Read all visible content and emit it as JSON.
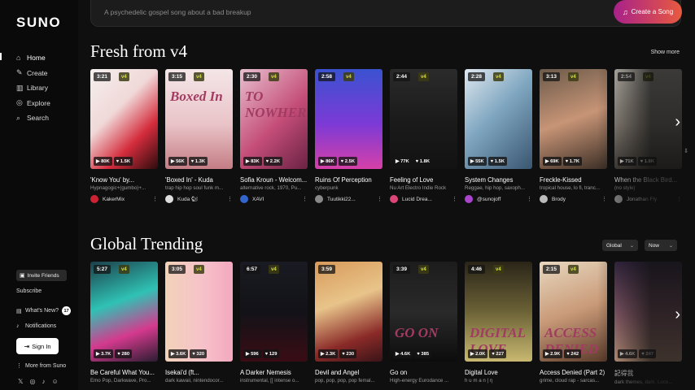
{
  "app": {
    "logo": "SUNO"
  },
  "nav": [
    {
      "label": "Home",
      "icon": "home-icon",
      "glyph": "⌂"
    },
    {
      "label": "Create",
      "icon": "create-icon",
      "glyph": "✎"
    },
    {
      "label": "Library",
      "icon": "library-icon",
      "glyph": "▥"
    },
    {
      "label": "Explore",
      "icon": "explore-icon",
      "glyph": "◎"
    },
    {
      "label": "Search",
      "icon": "search-icon",
      "glyph": "⌕"
    }
  ],
  "sidebar_bottom": {
    "invite": "Invite Friends",
    "subscribe": "Subscribe",
    "whats_new": "What's New?",
    "whats_new_count": "17",
    "notifications": "Notifications",
    "sign_in": "Sign In",
    "more_from": "More from Suno"
  },
  "search": {
    "placeholder": "A psychedelic gospel song about a bad breakup",
    "button": "Create a Song"
  },
  "sections": {
    "fresh": {
      "title": "Fresh from v4",
      "show_more": "Show more"
    },
    "trending": {
      "title": "Global Trending",
      "filter_region": "Global",
      "filter_time": "Now"
    }
  },
  "fresh_cards": [
    {
      "duration": "3:21",
      "version": "v4",
      "plays": "80K",
      "likes": "1.5K",
      "title": "'Know You' by...",
      "tags": "Hypnagogic+(gumbo)+...",
      "user": "KakerMix",
      "cover": "linear-gradient(135deg,#f5f0ee,#f0d8d8 40%,#d42c3c 70%,#2b0c0c)",
      "avatar": "#c23"
    },
    {
      "duration": "3:15",
      "version": "v4",
      "plays": "56K",
      "likes": "1.3K",
      "title": "'Boxed In' - Kuda",
      "tags": "trap hip hop soul funk m...",
      "user": "Kuda 🐿",
      "cover": "linear-gradient(180deg,#f4e6e8,#e9c4c8 55%,#c47d84)",
      "cover_text": "Boxed In",
      "avatar": "#ddd"
    },
    {
      "duration": "2:30",
      "version": "v4",
      "plays": "83K",
      "likes": "2.2K",
      "title": "Sofia Kroun - Welcom...",
      "tags": "alternative rock, 1970, Pu...",
      "user": "XAVI",
      "cover": "linear-gradient(135deg,#e8c0cf,#c44d78 55%,#6a2244)",
      "cover_text": "TO NOWHERE",
      "avatar": "#36c"
    },
    {
      "duration": "2:58",
      "version": "v4",
      "plays": "86K",
      "likes": "2.5K",
      "title": "Ruins Of Perception",
      "tags": "cyberpunk",
      "user": "Tuutikki22...",
      "cover": "linear-gradient(180deg,#3a52d0,#7c3ad6 55%,#d640a8)",
      "avatar": "#888"
    },
    {
      "duration": "2:44",
      "version": "v4",
      "plays": "77K",
      "likes": "1.8K",
      "title": "Feeling of Love",
      "tags": "Nu Art Electro Indie Rock",
      "user": "Lucid Drea...",
      "cover": "linear-gradient(180deg,#2b2b2b,#1b1b1b 50%,#121212)",
      "avatar": "#d47"
    },
    {
      "duration": "2:28",
      "version": "v4",
      "plays": "55K",
      "likes": "1.5K",
      "title": "System Changes",
      "tags": "Reggae, hip hop, saxoph...",
      "user": "@sunojoff",
      "cover": "linear-gradient(135deg,#dfe8f0,#7fa6c0 45%,#3a5570)",
      "avatar": "#a4c"
    },
    {
      "duration": "3:13",
      "version": "v4",
      "plays": "69K",
      "likes": "1.7K",
      "title": "Freckle-Kissed",
      "tags": "tropical house, lo fi, tranc...",
      "user": "Brody",
      "cover": "linear-gradient(160deg,#6b5a4a,#c79476 50%,#3b2e25)",
      "avatar": "#bbb"
    },
    {
      "duration": "2:54",
      "version": "v4",
      "plays": "71K",
      "likes": "1.8K",
      "title": "When the Black Bird...",
      "tags": "(no style)",
      "user": "Jonathan Fly",
      "cover": "linear-gradient(180deg,#d8d2c8,#9e958a 55%,#4a443e)",
      "avatar": "#999"
    }
  ],
  "trending_cards": [
    {
      "duration": "5:27",
      "version": "v4",
      "plays": "3.7K",
      "likes": "280",
      "title": "Be Careful What You...",
      "tags": "Emo Pop, Darkwave, Pro...",
      "cover": "linear-gradient(160deg,#1c3f4a,#2fc2b4 40%,#d43a8e 70%,#2a1c30)"
    },
    {
      "duration": "3:05",
      "version": "v4",
      "plays": "3.6K",
      "likes": "320",
      "title": "Isekai'd (ft...",
      "tags": "dark kawaii, nintendocor...",
      "cover": "linear-gradient(90deg,#f2d2b8,#f6c2ca 55%,#f4a8be)"
    },
    {
      "duration": "6:57",
      "version": "v4",
      "plays": "596",
      "likes": "129",
      "title": "A Darker Nemesis",
      "tags": "instrumental, [[ intense o...",
      "cover": "linear-gradient(180deg,#1a1a22,#121218 50%,#3a0c14)"
    },
    {
      "duration": "3:59",
      "version": "",
      "plays": "2.3K",
      "likes": "230",
      "title": "Devil and Angel",
      "tags": "pop, pop, pop, pop femal...",
      "cover": "linear-gradient(160deg,#d89a5a,#e8c48a 40%,#8a2a28 75%,#3a1418)"
    },
    {
      "duration": "3:39",
      "version": "v4",
      "plays": "4.6K",
      "likes": "385",
      "title": "Go on",
      "tags": "High-energy Eurodance ...",
      "cover": "linear-gradient(180deg,#1c1c1c,#2a2a2a 50%,#0c0c0c)",
      "cover_text": "GO ON"
    },
    {
      "duration": "4:46",
      "version": "v4",
      "plays": "2.0K",
      "likes": "227",
      "title": "Digital Love",
      "tags": "h u m a n | η",
      "cover": "linear-gradient(180deg,#2a2418,#6b6236 50%,#c8b870)",
      "cover_text": "DIGITAL LOVE"
    },
    {
      "duration": "2:15",
      "version": "v4",
      "plays": "2.9K",
      "likes": "242",
      "title": "Access Denied (Part 2)",
      "tags": "grime, cloud rap - sarcas...",
      "cover": "linear-gradient(160deg,#e8d8c0,#c99a78 50%,#5a3a2a)",
      "cover_text": "ACCESS DENIED"
    },
    {
      "duration": "",
      "version": "",
      "plays": "4.6K",
      "likes": "247",
      "title": "記得我",
      "tags": "dark themes, dark, Loco...",
      "cover": "linear-gradient(180deg,#3a2a4a,#a06a7a 55%,#e0b090)"
    }
  ]
}
